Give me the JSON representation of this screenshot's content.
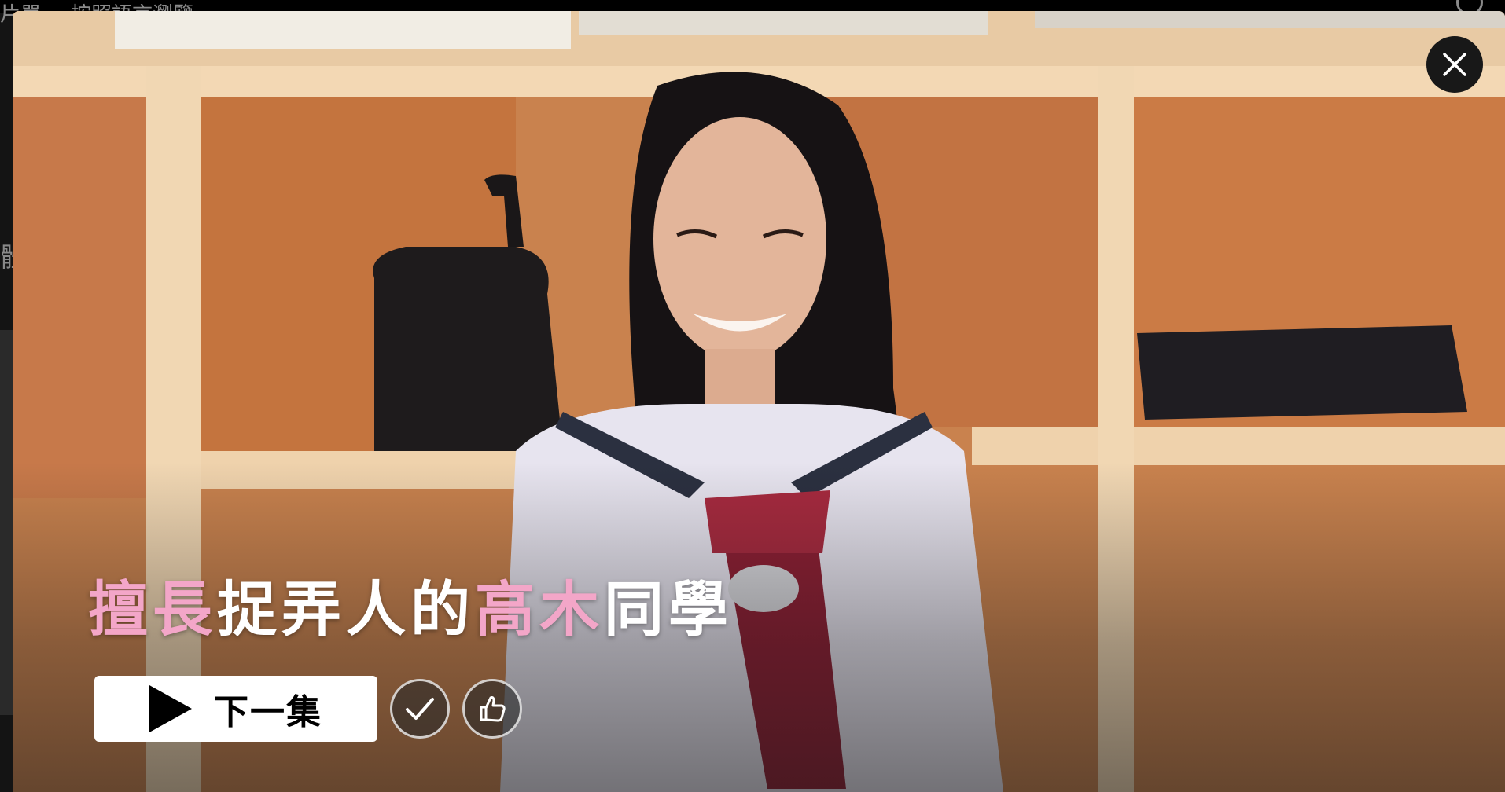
{
  "background_page": {
    "nav_items": [
      "片單",
      "按照語言瀏覽"
    ],
    "side_glyph": "體"
  },
  "modal": {
    "title": {
      "full": "擅長捉弄人的高木同學",
      "segments": [
        {
          "text": "擅長",
          "color": "pink"
        },
        {
          "text": "捉弄人的",
          "color": "white"
        },
        {
          "text": "高木",
          "color": "pink"
        },
        {
          "text": "同學",
          "color": "white"
        }
      ]
    },
    "play_button": {
      "label": "下一集",
      "icon": "play-icon"
    },
    "my_list_button": {
      "icon": "check-icon"
    },
    "rate_button": {
      "icon": "thumbs-up-icon"
    },
    "close_button": {
      "icon": "close-icon"
    }
  },
  "colors": {
    "title_pink": "#f3a6c8",
    "title_white": "#ffffff",
    "play_button_bg": "#ffffff",
    "close_button_bg": "#181818",
    "page_bg": "#141414"
  }
}
